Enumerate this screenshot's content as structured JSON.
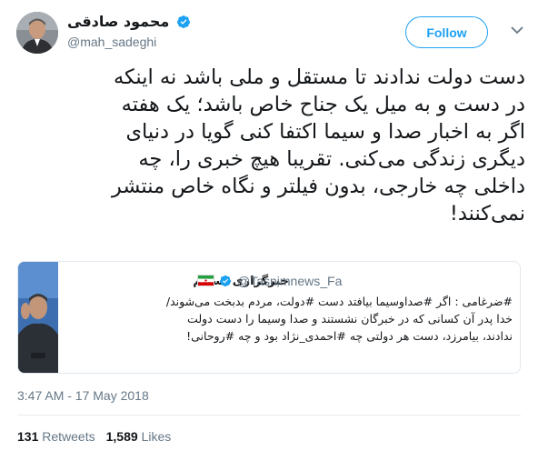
{
  "author": {
    "name": "محمود صادقی",
    "handle": "@mah_sadeghi",
    "verified": true,
    "follow_label": "Follow"
  },
  "tweet": {
    "text_lines": [
      "دست دولت ندادند تا مستقل و ملی باشد نه اینکه",
      "در دست و به میل یک جناح خاص باشد؛ یک هفته",
      "اگر به اخبار صدا و سیما اکتفا کنی گویا در دنیای",
      "دیگری زندگی می‌کنی. تقریبا هیچ خبری را، چه",
      "داخلی چه خارجی، بدون فیلتر و نگاه خاص منتشر",
      "نمی‌کنند!"
    ]
  },
  "quote": {
    "source_name": "خبرگزاری تسنیم",
    "handle": "@Tasnimnews_Fa",
    "verified": true,
    "flag": "iran-flag",
    "text_lines": [
      "#ضرغامی : اگر #صداوسیما بیافتد دست #دولت، مردم بدبخت می‌شوند/",
      "خدا پدر آن کسانی که در خبرگان نشستند و صدا وسیما را دست دولت",
      "ندادند، بیامرزد، دست هر دولتی چه #احمدی‌_نژاد بود و چه #روحانی!"
    ]
  },
  "timestamp": "3:47 AM - 17 May 2018",
  "stats": {
    "retweets_count": "131",
    "retweets_label": "Retweets",
    "likes_count": "1,589",
    "likes_label": "Likes"
  },
  "colors": {
    "brand_blue": "#1da1f2",
    "text_primary": "#14171a",
    "text_secondary": "#657786",
    "border": "#e1e8ed"
  },
  "icons": {
    "menu": "chevron-down-icon",
    "verified": "verified-badge-icon"
  }
}
